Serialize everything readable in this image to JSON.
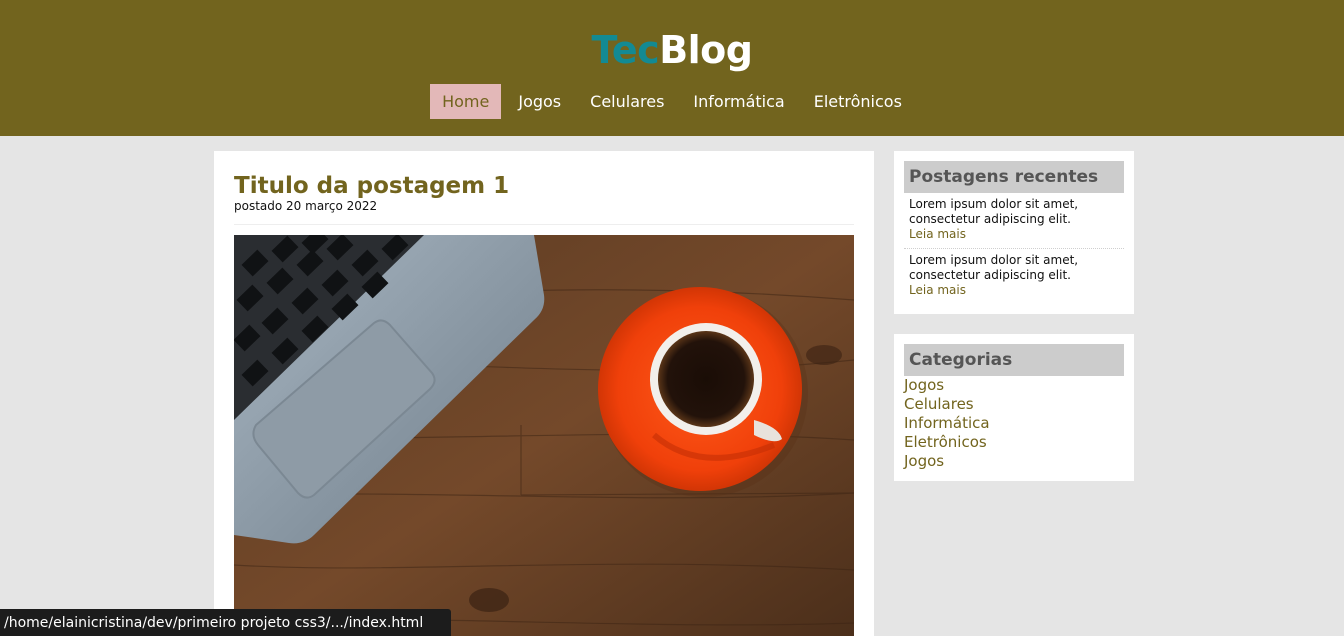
{
  "header": {
    "logo_part1": "Tec",
    "logo_part2": "Blog",
    "nav": [
      {
        "label": "Home",
        "active": true
      },
      {
        "label": "Jogos"
      },
      {
        "label": "Celulares"
      },
      {
        "label": "Informática"
      },
      {
        "label": "Eletrônicos"
      }
    ]
  },
  "post": {
    "title": "Titulo da postagem 1",
    "date": "postado 20 março 2022"
  },
  "sidebar": {
    "recent": {
      "heading": "Postagens recentes",
      "items": [
        {
          "text": "Lorem ipsum dolor sit amet, consectetur adipiscing elit.",
          "link": "Leia mais"
        },
        {
          "text": "Lorem ipsum dolor sit amet, consectetur adipiscing elit.",
          "link": "Leia mais"
        }
      ]
    },
    "categories": {
      "heading": "Categorias",
      "items": [
        "Jogos",
        "Celulares",
        "Informática",
        "Eletrônicos",
        "Jogos"
      ]
    }
  },
  "status_bar": {
    "url": "/home/elainicristina/dev/primeiro projeto css3/.../index.html"
  },
  "colors": {
    "header_bg": "#72641e",
    "logo_accent": "#138a93",
    "nav_active_bg": "#e3b8b8",
    "page_bg": "#e5e5e5"
  }
}
